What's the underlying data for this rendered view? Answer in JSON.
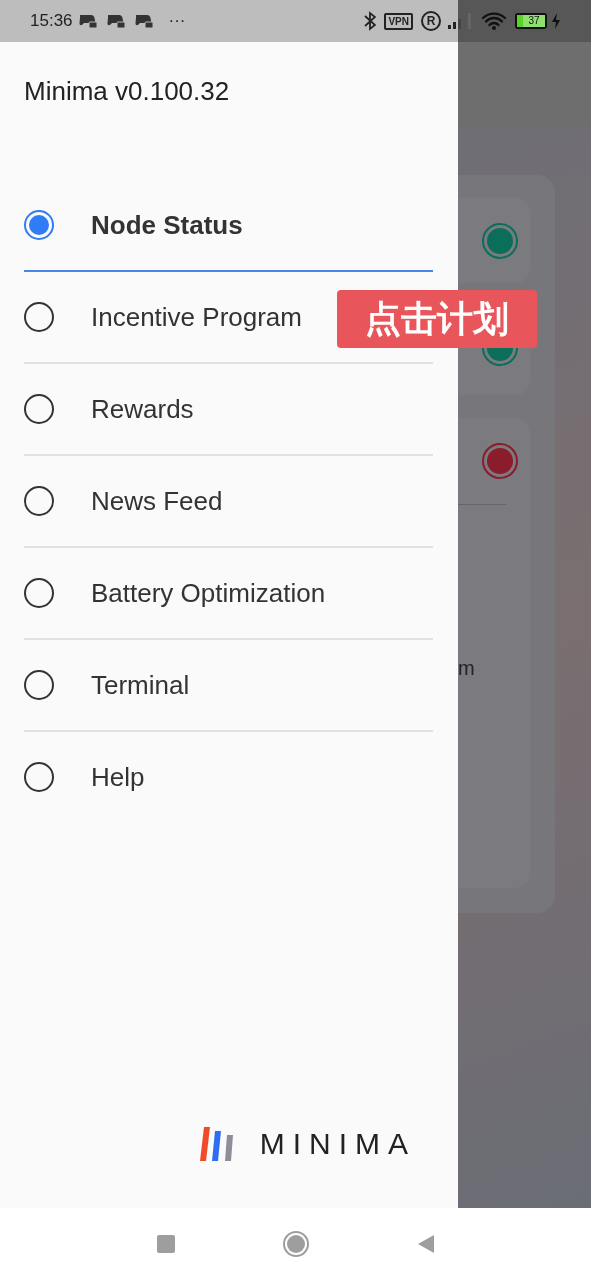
{
  "status_bar": {
    "time": "15:36",
    "more": "···",
    "vpn": "VPN",
    "registered": "R",
    "battery": "37"
  },
  "drawer": {
    "title": "Minima v0.100.32",
    "items": [
      {
        "label": "Node Status",
        "selected": true
      },
      {
        "label": "Incentive Program",
        "selected": false
      },
      {
        "label": "Rewards",
        "selected": false
      },
      {
        "label": "News Feed",
        "selected": false
      },
      {
        "label": "Battery Optimization",
        "selected": false
      },
      {
        "label": "Terminal",
        "selected": false
      },
      {
        "label": "Help",
        "selected": false
      }
    ],
    "logo_text": "MINIMA"
  },
  "background": {
    "status_dots": [
      {
        "color": "#0b6e5a"
      },
      {
        "color": "#0b6e5a"
      },
      {
        "color": "#8a1c2b"
      }
    ],
    "partial_text": "m"
  },
  "annotation": "点击计划"
}
